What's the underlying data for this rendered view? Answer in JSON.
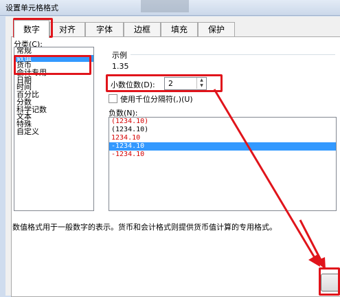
{
  "window": {
    "title": "设置单元格格式"
  },
  "tabs": [
    {
      "label": "数字",
      "active": true
    },
    {
      "label": "对齐"
    },
    {
      "label": "字体"
    },
    {
      "label": "边框"
    },
    {
      "label": "填充"
    },
    {
      "label": "保护"
    }
  ],
  "category": {
    "label": "分类(C):",
    "items": [
      "常规",
      "数值",
      "货币",
      "会计专用",
      "日期",
      "时间",
      "百分比",
      "分数",
      "科学记数",
      "文本",
      "特殊",
      "自定义"
    ],
    "selected": "数值"
  },
  "sample": {
    "label": "示例",
    "value": "1.35"
  },
  "decimal": {
    "label": "小数位数(D):",
    "value": "2"
  },
  "thousands": {
    "label": "使用千位分隔符(,)(U)",
    "checked": false
  },
  "negative": {
    "label": "负数(N):",
    "items": [
      "(1234.10)",
      "(1234.10)",
      "1234.10",
      "-1234.10",
      "-1234.10"
    ],
    "selected_index": 3,
    "red_indices": [
      0,
      2,
      4
    ]
  },
  "description": "数值格式用于一般数字的表示。货币和会计格式则提供货币值计算的专用格式。",
  "colors": {
    "highlight": "#e0141b",
    "selection": "#3399ff",
    "negative_red": "#d40000"
  }
}
